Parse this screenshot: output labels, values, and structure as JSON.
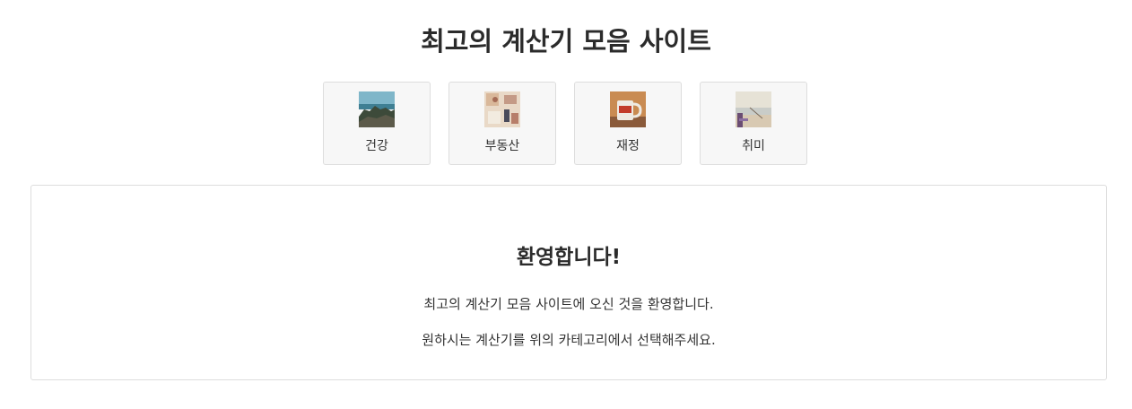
{
  "header": {
    "title": "최고의 계산기 모음 사이트"
  },
  "categories": [
    {
      "label": "건강",
      "icon": "mountain-landscape-thumbnail"
    },
    {
      "label": "부동산",
      "icon": "house-interior-thumbnail"
    },
    {
      "label": "재정",
      "icon": "coffee-mug-thumbnail"
    },
    {
      "label": "취미",
      "icon": "beach-hobby-thumbnail"
    }
  ],
  "welcome": {
    "title": "환영합니다!",
    "line1": "최고의 계산기 모음 사이트에 오신 것을 환영합니다.",
    "line2": "원하시는 계산기를 위의 카테고리에서 선택해주세요."
  },
  "colors": {
    "text": "#333333",
    "title": "#2b2b2b",
    "card_bg": "#f7f7f7",
    "border": "#dddddd"
  }
}
